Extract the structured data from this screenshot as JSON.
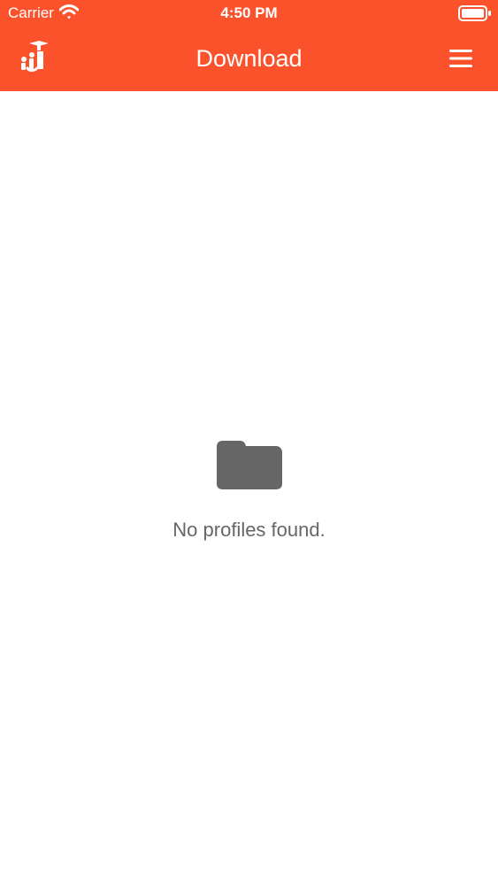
{
  "status_bar": {
    "carrier": "Carrier",
    "time": "4:50 PM",
    "wifi_icon": "wifi-icon",
    "battery_icon": "battery-icon"
  },
  "header": {
    "title": "Download",
    "logo_icon": "graduation-logo-icon",
    "menu_icon": "hamburger-menu-icon",
    "background_color": "#fc522b"
  },
  "content": {
    "empty_icon": "folder-icon",
    "empty_message": "No profiles found.",
    "message_color": "#666666"
  }
}
